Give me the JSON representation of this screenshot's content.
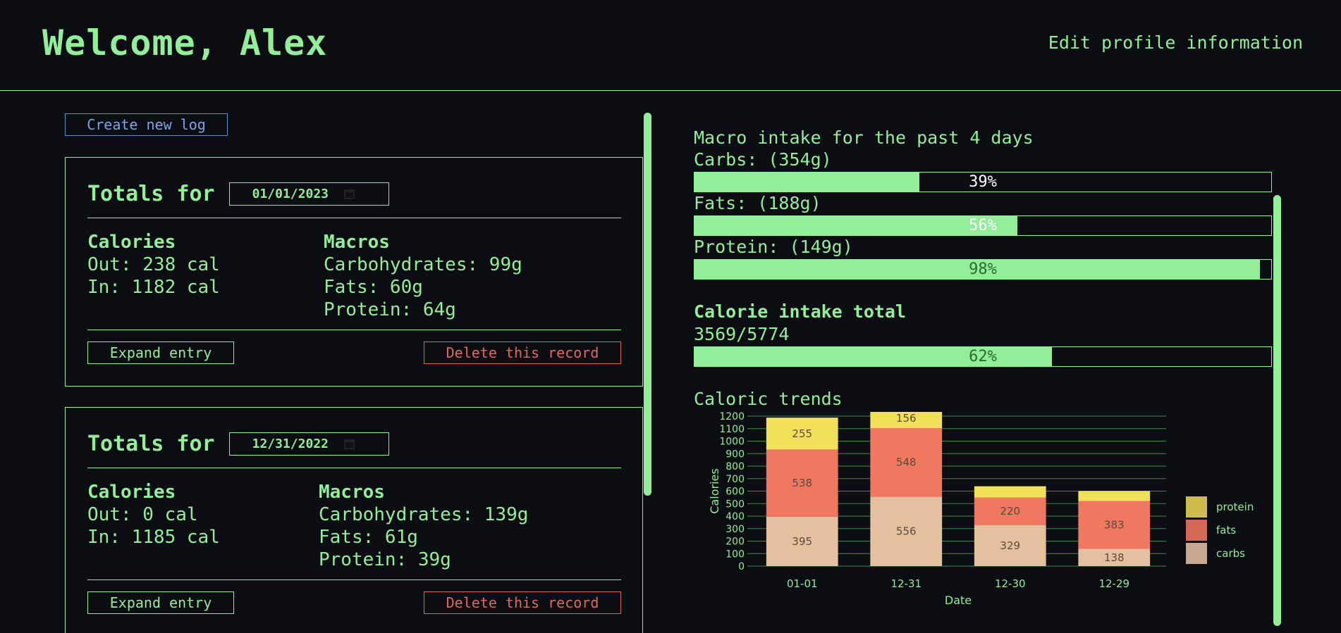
{
  "header": {
    "welcome": "Welcome, Alex",
    "edit_profile": "Edit profile information"
  },
  "logs": {
    "create_label": "Create new log",
    "entries": [
      {
        "totals_label": "Totals for",
        "date": "01/01/2023",
        "calories_title": "Calories",
        "out": "Out: 238 cal",
        "in": "In: 1182 cal",
        "macros_title": "Macros",
        "carbs": "Carbohydrates: 99g",
        "fats": "Fats: 60g",
        "protein": "Protein: 64g",
        "expand_label": "Expand entry",
        "delete_label": "Delete this record"
      },
      {
        "totals_label": "Totals for",
        "date": "12/31/2022",
        "calories_title": "Calories",
        "out": "Out: 0 cal",
        "in": "In: 1185 cal",
        "macros_title": "Macros",
        "carbs": "Carbohydrates: 139g",
        "fats": "Fats: 61g",
        "protein": "Protein: 39g",
        "expand_label": "Expand entry",
        "delete_label": "Delete this record"
      }
    ]
  },
  "summary": {
    "macro_title": "Macro intake for the past 4 days",
    "carbs_label": "Carbs: (354g)",
    "carbs_pct": "39%",
    "carbs_fraction": 0.39,
    "fats_label": "Fats: (188g)",
    "fats_pct": "56%",
    "fats_fraction": 0.56,
    "protein_label": "Protein: (149g)",
    "protein_pct": "98%",
    "protein_fraction": 0.98,
    "calorie_title": "Calorie intake total",
    "calorie_value": "3569/5774",
    "calorie_pct": "62%",
    "calorie_fraction": 0.62,
    "trends_title": "Caloric trends"
  },
  "colors": {
    "accent": "#93ee99",
    "background": "#0d0e13",
    "create_button": "#7aa6e8",
    "delete_button": "#e0685f"
  },
  "icons": {
    "date_picker": "calendar-icon"
  },
  "chart_data": {
    "type": "bar",
    "stacked": true,
    "categories": [
      "01-01",
      "12-31",
      "12-30",
      "12-29"
    ],
    "series": [
      {
        "name": "carbs",
        "values": [
          395,
          556,
          329,
          138
        ],
        "color": "#e5c09f"
      },
      {
        "name": "fats",
        "values": [
          538,
          548,
          220,
          383
        ],
        "color": "#f07860"
      },
      {
        "name": "protein",
        "values": [
          255,
          156,
          90,
          80
        ],
        "color": "#f2e05a"
      }
    ],
    "data_labels": {
      "carbs": [
        "395",
        "556",
        "329",
        "138"
      ],
      "fats": [
        "538",
        "548",
        "220",
        "383"
      ],
      "protein": [
        "255",
        "156",
        "",
        ""
      ]
    },
    "xlabel": "Date",
    "ylabel": "Calories",
    "ylim": [
      0,
      1200
    ],
    "yticks": [
      0,
      100,
      200,
      300,
      400,
      500,
      600,
      700,
      800,
      900,
      1000,
      1100,
      1200
    ],
    "grid": true,
    "legend": "right"
  }
}
